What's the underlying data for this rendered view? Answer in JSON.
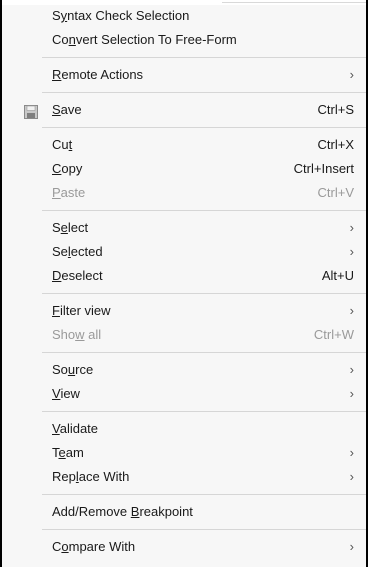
{
  "menu": {
    "syntax_check": {
      "pre": "S",
      "mn": "y",
      "post": "ntax Check Selection"
    },
    "convert_free_form": {
      "pre": "Co",
      "mn": "n",
      "post": "vert Selection To Free-Form"
    },
    "remote_actions": {
      "pre": "",
      "mn": "R",
      "post": "emote Actions",
      "arrow": "›"
    },
    "save": {
      "pre": "",
      "mn": "S",
      "post": "ave",
      "shortcut": "Ctrl+S",
      "icon": "save-icon"
    },
    "cut": {
      "pre": "Cu",
      "mn": "t",
      "post": "",
      "shortcut": "Ctrl+X"
    },
    "copy": {
      "pre": "",
      "mn": "C",
      "post": "opy",
      "shortcut": "Ctrl+Insert"
    },
    "paste": {
      "pre": "",
      "mn": "P",
      "post": "aste",
      "shortcut": "Ctrl+V",
      "disabled": true
    },
    "select": {
      "pre": "S",
      "mn": "e",
      "post": "lect",
      "arrow": "›"
    },
    "selected": {
      "pre": "Se",
      "mn": "l",
      "post": "ected",
      "arrow": "›"
    },
    "deselect": {
      "pre": "",
      "mn": "D",
      "post": "eselect",
      "shortcut": "Alt+U"
    },
    "filter_view": {
      "pre": "",
      "mn": "F",
      "post": "ilter view",
      "arrow": "›"
    },
    "show_all": {
      "pre": "Sho",
      "mn": "w",
      "post": " all",
      "shortcut": "Ctrl+W",
      "disabled": true
    },
    "source": {
      "pre": "So",
      "mn": "u",
      "post": "rce",
      "arrow": "›"
    },
    "view": {
      "pre": "",
      "mn": "V",
      "post": "iew",
      "arrow": "›"
    },
    "validate": {
      "pre": "",
      "mn": "V",
      "post": "alidate"
    },
    "team": {
      "pre": "T",
      "mn": "e",
      "post": "am",
      "arrow": "›"
    },
    "replace_with": {
      "pre": "Rep",
      "mn": "l",
      "post": "ace With",
      "arrow": "›"
    },
    "add_remove_breakpoint": {
      "pre": "Add/Remove ",
      "mn": "B",
      "post": "reakpoint"
    },
    "compare_with": {
      "pre": "C",
      "mn": "o",
      "post": "mpare With",
      "arrow": "›"
    }
  }
}
